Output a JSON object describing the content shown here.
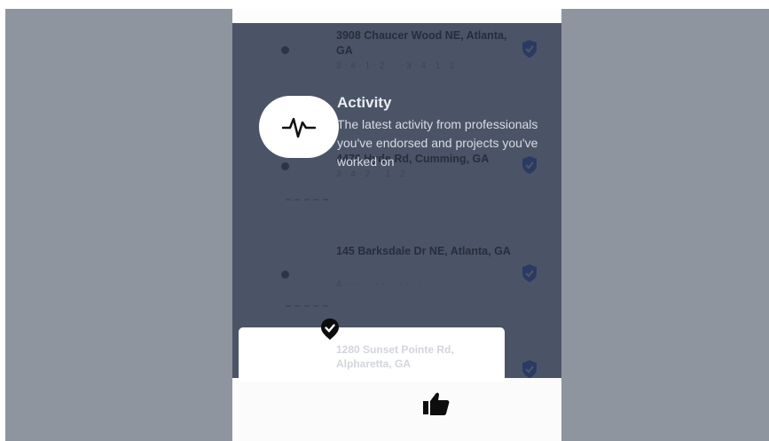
{
  "list": {
    "items": [
      {
        "address": "3908 Chaucer Wood NE, Atlanta, GA",
        "meta": "3 ⋅ 4 ⋅ 1 ⋅ 2 ⋅ ⋅ ⋅ 3 ⋅ 4 ⋅ 1 ⋅ 2 ⋅"
      },
      {
        "address": "4476 Hyde Rd, Cumming, GA",
        "meta": "3 ⋅ 4 ⋅ 2 ⋅ ⋅ 1 ⋅ 2 ⋅"
      },
      {
        "address": "145 Barksdale Dr NE, Atlanta, GA",
        "meta": "4 ⋅ ⋅ ⋅ ⋅ ⋅ ⋅ ⋅ ⋅ ⋅ ⋅ ⋅ ⋅ ⋅"
      }
    ]
  },
  "tooltip": {
    "icon": "activity-pulse-icon",
    "title": "Activity",
    "text": "The latest activity from professionals you've endorsed and projects you've worked on"
  },
  "toast": {
    "icon": "verified-badge-icon",
    "text": "1280 Sunset Pointe Rd, Alpharetta, GA"
  },
  "bottom_bar": {
    "icon": "thumbs-up-icon"
  },
  "colors": {
    "background": "#8f959f",
    "overlay": "#4b5466",
    "accent": "#2f3a55"
  }
}
